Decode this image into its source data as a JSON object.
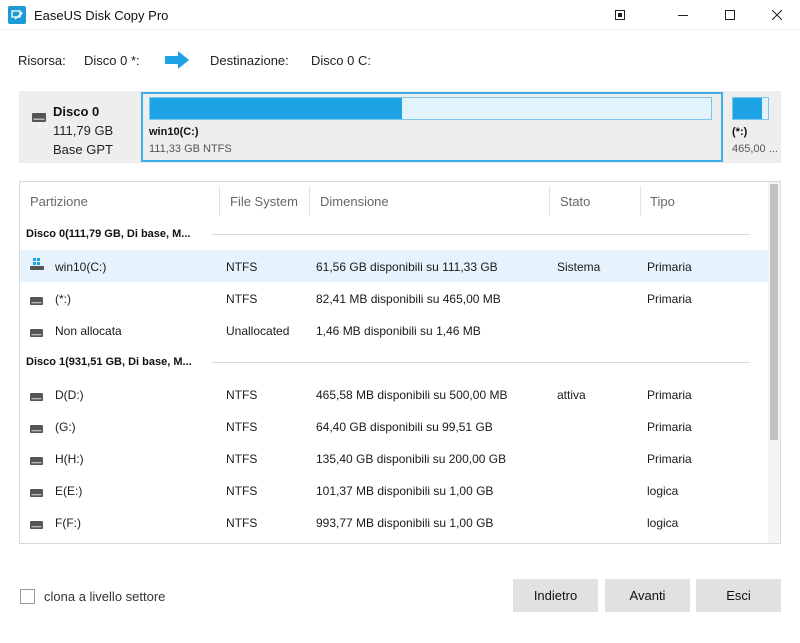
{
  "window": {
    "title": "EaseUS Disk Copy Pro",
    "controls": [
      "restore-icon",
      "minimize-icon",
      "maximize-icon",
      "close-icon"
    ]
  },
  "route": {
    "source_label": "Risorsa:",
    "source_value": "Disco 0 *:",
    "dest_label": "Destinazione:",
    "dest_value": "Disco 0 C:"
  },
  "disk_panel": {
    "name": "Disco 0",
    "size": "111,79 GB",
    "type": "Base GPT",
    "partitions": [
      {
        "name": "win10(C:)",
        "size": "111,33 GB NTFS",
        "used_fraction": 0.45
      },
      {
        "name": "(*:)",
        "size": "465,00 ...",
        "used_fraction": 0.82
      }
    ]
  },
  "table": {
    "headers": [
      "Partizione",
      "File System",
      "Dimensione",
      "Stato",
      "Tipo"
    ],
    "groups": [
      {
        "label": "Disco 0(111,79 GB, Di base, M...",
        "rows": [
          {
            "partition": "win10(C:)",
            "fs": "NTFS",
            "size": "61,56 GB disponibili su 111,33 GB",
            "status": "Sistema",
            "type": "Primaria",
            "icon": "windows-drive-icon",
            "selected": true
          },
          {
            "partition": "(*:)",
            "fs": "NTFS",
            "size": "82,41 MB disponibili su 465,00 MB",
            "status": "",
            "type": "Primaria",
            "icon": "drive-icon",
            "selected": false
          },
          {
            "partition": "Non allocata",
            "fs": "Unallocated",
            "size": "1,46 MB disponibili su 1,46 MB",
            "status": "",
            "type": "",
            "icon": "drive-icon",
            "selected": false
          }
        ]
      },
      {
        "label": "Disco 1(931,51 GB, Di base, M...",
        "rows": [
          {
            "partition": "D(D:)",
            "fs": "NTFS",
            "size": "465,58 MB disponibili su 500,00 MB",
            "status": "attiva",
            "type": "Primaria",
            "icon": "drive-icon",
            "selected": false
          },
          {
            "partition": "(G:)",
            "fs": "NTFS",
            "size": "64,40 GB disponibili su 99,51 GB",
            "status": "",
            "type": "Primaria",
            "icon": "drive-icon",
            "selected": false
          },
          {
            "partition": "H(H:)",
            "fs": "NTFS",
            "size": "135,40 GB disponibili su 200,00 GB",
            "status": "",
            "type": "Primaria",
            "icon": "drive-icon",
            "selected": false
          },
          {
            "partition": "E(E:)",
            "fs": "NTFS",
            "size": "101,37 MB disponibili su 1,00 GB",
            "status": "",
            "type": "logica",
            "icon": "drive-icon",
            "selected": false
          },
          {
            "partition": "F(F:)",
            "fs": "NTFS",
            "size": "993,77 MB disponibili su 1,00 GB",
            "status": "",
            "type": "logica",
            "icon": "drive-icon",
            "selected": false
          }
        ]
      }
    ]
  },
  "footer": {
    "checkbox_label": "clona a livello settore",
    "checkbox_checked": false,
    "back_label": "Indietro",
    "next_label": "Avanti",
    "exit_label": "Esci"
  },
  "colors": {
    "accent": "#1ea3e5",
    "selection": "#e6f2fc",
    "panel": "#eeeeee"
  }
}
